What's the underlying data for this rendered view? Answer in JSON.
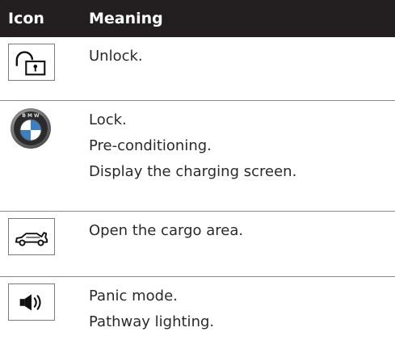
{
  "header": {
    "icon_label": "Icon",
    "meaning_label": "Meaning"
  },
  "rows": [
    {
      "icon": "unlock-icon",
      "lines": [
        "Unlock."
      ]
    },
    {
      "icon": "bmw-logo-icon",
      "lines": [
        "Lock.",
        "Pre-conditioning.",
        "Display the charging screen."
      ]
    },
    {
      "icon": "car-trunk-icon",
      "lines": [
        "Open the cargo area."
      ]
    },
    {
      "icon": "speaker-icon",
      "lines": [
        "Panic mode.",
        "Pathway lighting."
      ]
    }
  ],
  "colors": {
    "header_bg": "#231f20",
    "header_text": "#ffffff",
    "divider": "#8a8a8a",
    "bmw_blue": "#3d7fc4"
  }
}
